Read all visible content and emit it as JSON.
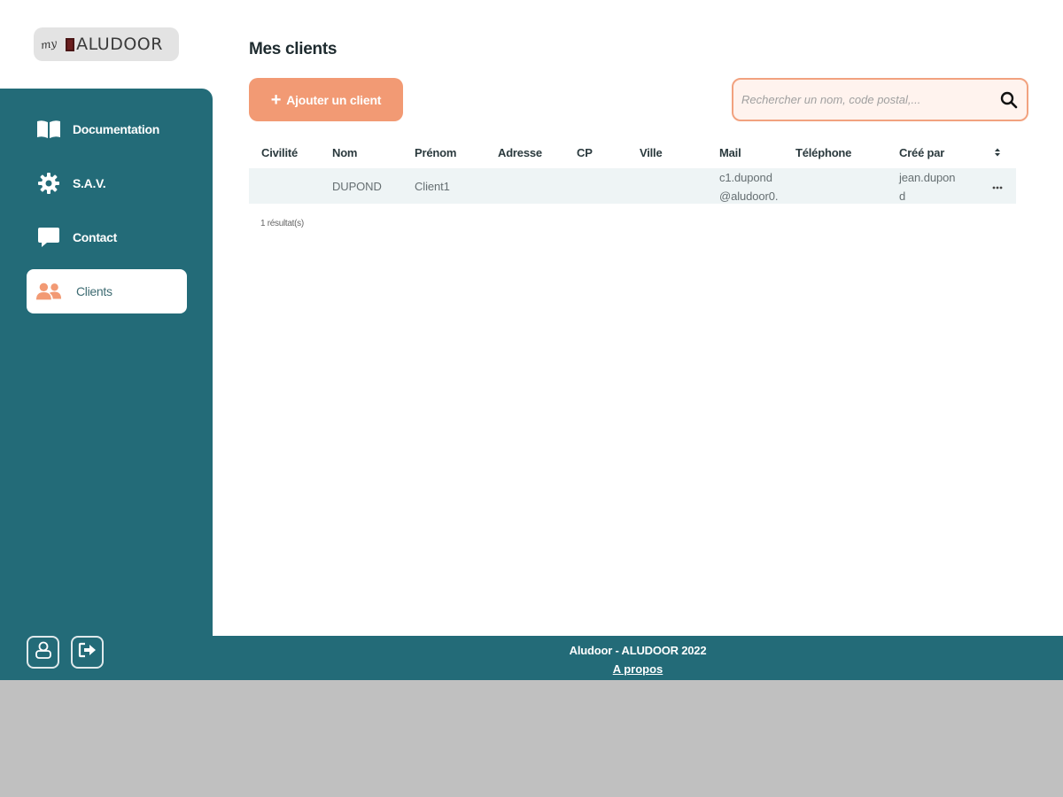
{
  "brand": {
    "logo_prefix": "my",
    "logo_name": "ALUDOOR"
  },
  "sidebar": {
    "items": [
      {
        "label": "Documentation",
        "icon": "book-icon",
        "active": false
      },
      {
        "label": "S.A.V.",
        "icon": "gear-icon",
        "active": false
      },
      {
        "label": "Contact",
        "icon": "chat-bubble-icon",
        "active": false
      },
      {
        "label": "Clients",
        "icon": "users-icon",
        "active": true
      }
    ],
    "bottom_buttons": [
      {
        "icon": "user-profile-icon"
      },
      {
        "icon": "logout-icon"
      }
    ]
  },
  "main": {
    "title": "Mes clients",
    "add_button_label": "Ajouter un client",
    "search_placeholder": "Rechercher un nom, code postal,...",
    "table": {
      "columns": [
        "Civilité",
        "Nom",
        "Prénom",
        "Adresse",
        "CP",
        "Ville",
        "Mail",
        "Téléphone",
        "Créé par"
      ],
      "rows": [
        {
          "civilite": "",
          "nom": "DUPOND",
          "prenom": "Client1",
          "adresse": "",
          "cp": "",
          "ville": "",
          "mail_line1": "c1.dupond",
          "mail_line2": "@aludoor0.",
          "telephone": "",
          "cree_par_line1": "jean.dupon",
          "cree_par_line2": "d"
        }
      ]
    },
    "results_text": "1 résultat(s)"
  },
  "footer": {
    "title": "Aludoor - ALUDOOR 2022",
    "link": "A propos"
  },
  "colors": {
    "teal": "#236b78",
    "accent": "#f29a74",
    "background": "#ffffff"
  }
}
